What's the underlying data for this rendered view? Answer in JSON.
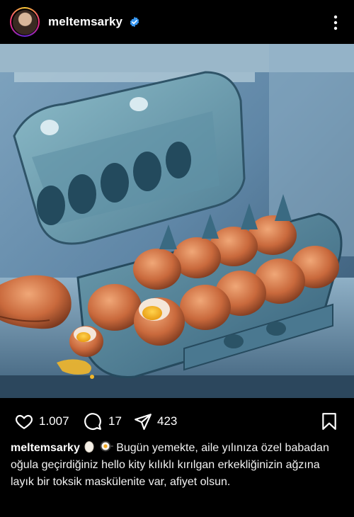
{
  "post": {
    "username": "meltemsarky",
    "verified": true
  },
  "actions": {
    "likes": "1.007",
    "comments": "17",
    "shares": "423"
  },
  "caption": {
    "username": "meltemsarky",
    "text": "Bugün yemekte, aile yılınıza özel babadan oğula geçirdiğiniz hello kity kılıklı kırılgan erkekliğinizin ağzına layık bir toksik maskülenite var, afiyet olsun."
  },
  "icons": {
    "verified": "verified-badge-icon",
    "more": "more-vertical-icon",
    "like": "heart-icon",
    "comment": "speech-bubble-icon",
    "share": "paper-plane-icon",
    "save": "bookmark-icon"
  },
  "colors": {
    "background": "#000000",
    "verified_blue": "#3897f0",
    "text": "#ffffff"
  }
}
